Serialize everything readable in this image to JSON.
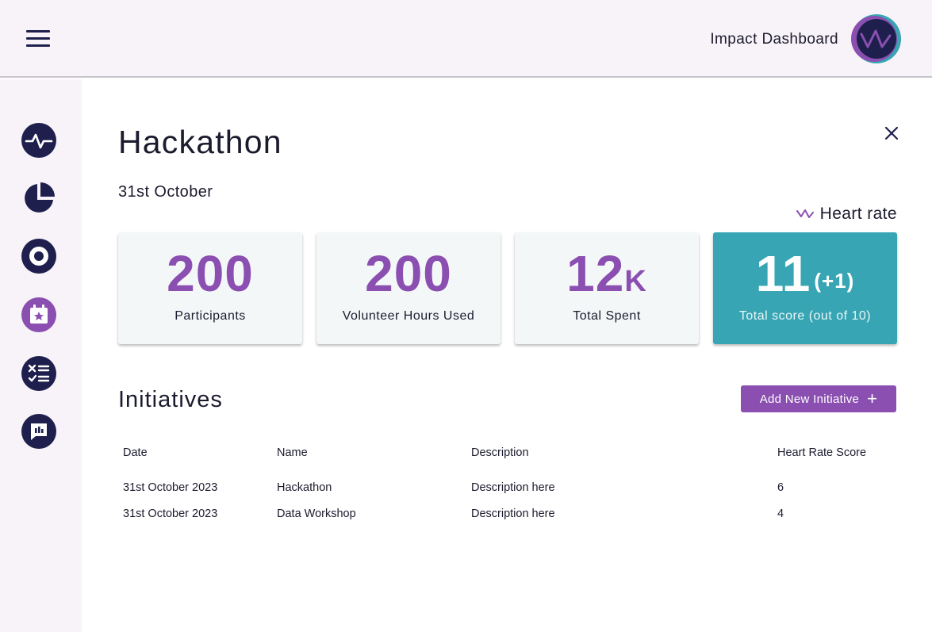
{
  "header": {
    "app_title": "Impact Dashboard"
  },
  "sidebar": {
    "items": [
      {
        "icon": "pulse-icon"
      },
      {
        "icon": "pie-chart-icon"
      },
      {
        "icon": "target-icon"
      },
      {
        "icon": "event-calendar-icon",
        "active": true
      },
      {
        "icon": "checklist-icon"
      },
      {
        "icon": "bar-chart-icon"
      }
    ]
  },
  "page": {
    "title": "Hackathon",
    "date": "31st October",
    "legend_label": "Heart rate"
  },
  "cards": [
    {
      "value": "200",
      "suffix": "",
      "label": "Participants"
    },
    {
      "value": "200",
      "suffix": "",
      "label": "Volunteer Hours Used"
    },
    {
      "value": "12",
      "suffix": "K",
      "label": "Total Spent"
    },
    {
      "value": "11",
      "suffix": "(+1)",
      "label": "Total score (out of 10)"
    }
  ],
  "initiatives": {
    "title": "Initiatives",
    "add_button_label": "Add New Initiative",
    "columns": [
      "Date",
      "Name",
      "Description",
      "Heart Rate Score"
    ],
    "rows": [
      [
        "31st October 2023",
        "Hackathon",
        "Description here",
        "6"
      ],
      [
        "31st October 2023",
        "Data Workshop",
        "Description here",
        "4"
      ]
    ]
  },
  "colors": {
    "accent_purple": "#8a4fb0",
    "navy": "#1e1f4d",
    "teal": "#37a5b3",
    "sidebar_bg": "#f8f3f8"
  }
}
